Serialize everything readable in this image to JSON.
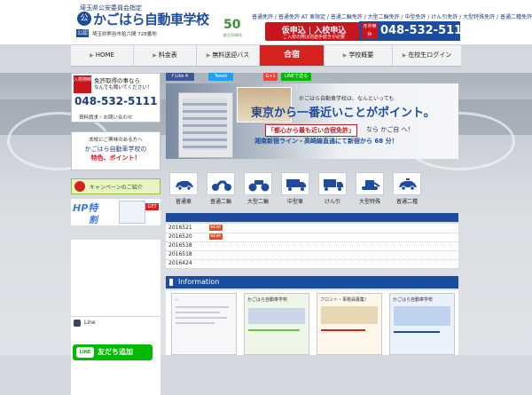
{
  "header": {
    "sub": "埼玉県公安委員会指定",
    "logo_badge": "公",
    "logo": "かごはら自動車学校",
    "tag": "公認",
    "address": "埼玉県熊谷市拾六間 728番地",
    "anniv": "50",
    "anniv_sub": "創立50周年",
    "courses": "普通免許 / 普通免許 AT 車限定 / 普通二輪免許 / 大型二輪免許 / 中型免許 / けん引免許 / 大型特殊免許 / 普通二種免許",
    "enroll_note": "通学・合宿・通学合宿ボタン比較",
    "enroll_title": "仮申込 | 入校申込",
    "enroll_sub": "ご入校の際は別途手続きが必要",
    "tel_badge": "年中無休",
    "tel": "048-532-5111"
  },
  "nav": {
    "items": [
      {
        "label": "HOME"
      },
      {
        "label": "料金表"
      },
      {
        "label": "無料送迎バス"
      },
      {
        "label": "合宿"
      },
      {
        "label": "学校概要"
      },
      {
        "label": "在校生ログイン"
      }
    ]
  },
  "left": {
    "tel_ribbon": "入校随時",
    "tel_l1": "免許取得の事なら",
    "tel_l2": "なんでも聞いてください！",
    "tel_num": "048-532-5111",
    "tel_l3": "資料請求・お問い合わせ",
    "feat_l1": "本校にご興味のある方へ",
    "feat_l2": "かごはら自動車学校の",
    "feat_l3": "特色、ポイント！",
    "campaign": "キャンペーンのご紹介",
    "hp1": "HP特",
    "hp2": "割",
    "get": "GET",
    "blank_q": "?",
    "line_label": "Line",
    "line_logo": "LINE",
    "line_btn": "友だち追加"
  },
  "share": {
    "fb": "f Like 4",
    "tw": "Tweet",
    "gp": "G+1",
    "line": "LINEで送る"
  },
  "hero": {
    "t1": "かごはら自動車学校は、なんといっても",
    "t2": "東京から一番近いことがポイント。",
    "t3": "「都心から最も近い合宿免許」",
    "t3b": "なら かご自 へ！",
    "t4": "湘南新宿ライン・高崎線直通にて新宿から 68 分！"
  },
  "vehicles": [
    {
      "label": "普通車",
      "icon": "car-icon"
    },
    {
      "label": "普通二輪",
      "icon": "motorcycle-icon"
    },
    {
      "label": "大型二輪",
      "icon": "large-motorcycle-icon"
    },
    {
      "label": "中型車",
      "icon": "medium-truck-icon"
    },
    {
      "label": "けん引",
      "icon": "trailer-icon"
    },
    {
      "label": "大型特殊",
      "icon": "special-vehicle-icon"
    },
    {
      "label": "普通二種",
      "icon": "taxi-icon"
    }
  ],
  "news": [
    {
      "date": "2016521",
      "new": "NEW!"
    },
    {
      "date": "2016520",
      "new": "NEW!"
    },
    {
      "date": "2016518",
      "new": ""
    },
    {
      "date": "2016518",
      "new": ""
    },
    {
      "date": "2016424",
      "new": ""
    }
  ],
  "info": {
    "title": "Information",
    "cards": [
      {
        "head": "..."
      },
      {
        "head": "かごはら自動車学校"
      },
      {
        "head": "フロント・事務員募集！"
      },
      {
        "head": "かごはら自動車学校"
      }
    ]
  },
  "colors": {
    "accent": "#1d4c9e",
    "red": "#c9151e",
    "line_green": "#00b900"
  }
}
